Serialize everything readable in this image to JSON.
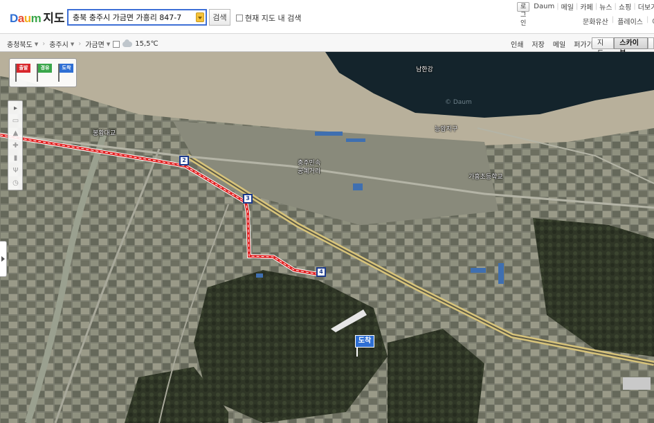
{
  "header": {
    "brand": [
      "D",
      "a",
      "u",
      "m"
    ],
    "brand_colors": [
      "#2f6fd4",
      "#e84a2d",
      "#f2b11c",
      "#3aa64a"
    ],
    "service": "지도",
    "search_value": "충북 충주시 가금면 가흥리 847-7",
    "search_button": "검색",
    "in_map_label": "현재 지도 내 검색",
    "login": "로그인",
    "top_links": [
      "Daum",
      "메일",
      "카페",
      "뉴스",
      "쇼핑",
      "더보기"
    ],
    "sub_links": [
      "문화유산",
      "플레이스",
      "여"
    ]
  },
  "locbar": {
    "crumbs": [
      "충청북도",
      "충주시",
      "가금면"
    ],
    "weather_icon": "cloud-icon",
    "temperature": "15,5℃",
    "tools": [
      "인쇄",
      "저장",
      "메일",
      "퍼가기"
    ],
    "map_types": [
      "지도",
      "스카이뷰"
    ],
    "active_type": "스카이뷰"
  },
  "route_panel": {
    "flags": [
      {
        "label": "출발",
        "color": "#d8262b"
      },
      {
        "label": "경유",
        "color": "#3aa64a"
      },
      {
        "label": "도착",
        "color": "#2f6fd4"
      }
    ]
  },
  "side_tools": [
    "arrow-icon",
    "bus-icon",
    "cafe-icon",
    "hospital-icon",
    "gas-icon",
    "restaurant-icon",
    "clock-icon"
  ],
  "map_labels": {
    "river": "남한강",
    "daum_watermark": "© Daum",
    "district": "능암지구",
    "bridge": "봉황대교",
    "craft_street": "충주민속",
    "craft_street_2": "공예거리",
    "school": "가흥초등학교"
  },
  "markers": [
    "2",
    "3",
    "4"
  ],
  "arrival_label": "도착",
  "colors": {
    "route": "#e02020",
    "accent": "#3d6fd6",
    "river": "#14242c"
  }
}
